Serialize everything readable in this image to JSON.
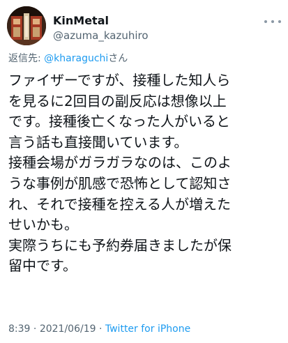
{
  "user": {
    "display_name": "KinMetal",
    "handle": "@azuma_kazuhiro"
  },
  "reply": {
    "prefix": "返信先: ",
    "mention": "@kharaguchi",
    "suffix": "さん"
  },
  "tweet_lines": [
    "ファイザーですが、接種した知人ら",
    "を見るに2回目の副反応は想像以上",
    "です。接種後亡くなった人がいると",
    "言う話も直接聞いています。",
    "接種会場がガラガラなのは、このよ",
    "うな事例が肌感で恐怖として認知さ",
    "れ、それで接種を控える人が増えた",
    "せいかも。",
    "実際うちにも予約券届きましたが保",
    "留中です。"
  ],
  "meta": {
    "time": "8:39",
    "separator1": " · ",
    "date": "2021/06/19",
    "separator2": " · ",
    "source": "Twitter for iPhone"
  },
  "icons": {
    "avatar": "avatar-image",
    "more": "more-options-icon"
  },
  "colors": {
    "text": "#0f1419",
    "secondary": "#536471",
    "link": "#1d9bf0"
  }
}
